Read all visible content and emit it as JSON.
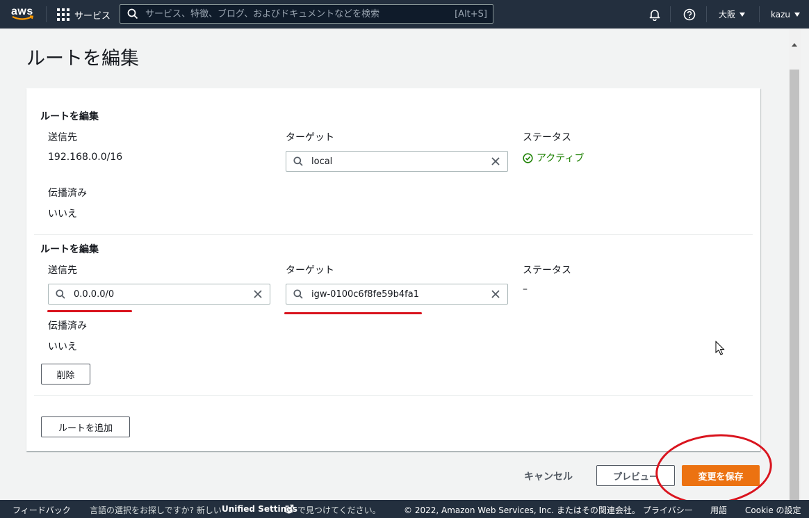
{
  "nav": {
    "logo": "aws",
    "services_label": "サービス",
    "search_placeholder": "サービス、特徴、ブログ、およびドキュメントなどを検索",
    "search_shortcut": "[Alt+S]",
    "region": "大阪",
    "user": "kazu"
  },
  "page": {
    "title": "ルートを編集"
  },
  "routes": [
    {
      "section_title": "ルートを編集",
      "destination_label": "送信先",
      "destination_value": "192.168.0.0/16",
      "target_label": "ターゲット",
      "target_value": "local",
      "status_label": "ステータス",
      "status_value": "アクティブ",
      "propagated_label": "伝播済み",
      "propagated_value": "いいえ"
    },
    {
      "section_title": "ルートを編集",
      "destination_label": "送信先",
      "destination_value": "0.0.0.0/0",
      "target_label": "ターゲット",
      "target_value": "igw-0100c6f8fe59b4fa1",
      "status_label": "ステータス",
      "status_value": "–",
      "propagated_label": "伝播済み",
      "propagated_value": "いいえ",
      "remove_label": "削除"
    }
  ],
  "add_route_label": "ルートを追加",
  "actions": {
    "cancel": "キャンセル",
    "preview": "プレビュー",
    "save": "変更を保存"
  },
  "footer": {
    "feedback": "フィードバック",
    "lang_prompt": "言語の選択をお探しですか? 新しい",
    "unified_settings": "Unified Settings",
    "lang_suffix": "で見つけてください。",
    "copyright": "© 2022, Amazon Web Services, Inc. またはその関連会社。",
    "privacy": "プライバシー",
    "terms": "用語",
    "cookie": "Cookie の設定"
  },
  "colors": {
    "nav_bg": "#232f3e",
    "primary": "#ec7211",
    "active_status": "#1d8102",
    "annotation": "#d9141e"
  },
  "icons": [
    "search-icon",
    "grid-icon",
    "bell-icon",
    "help-icon",
    "check-circle-icon",
    "clear-icon",
    "external-link-icon",
    "cursor-icon"
  ]
}
